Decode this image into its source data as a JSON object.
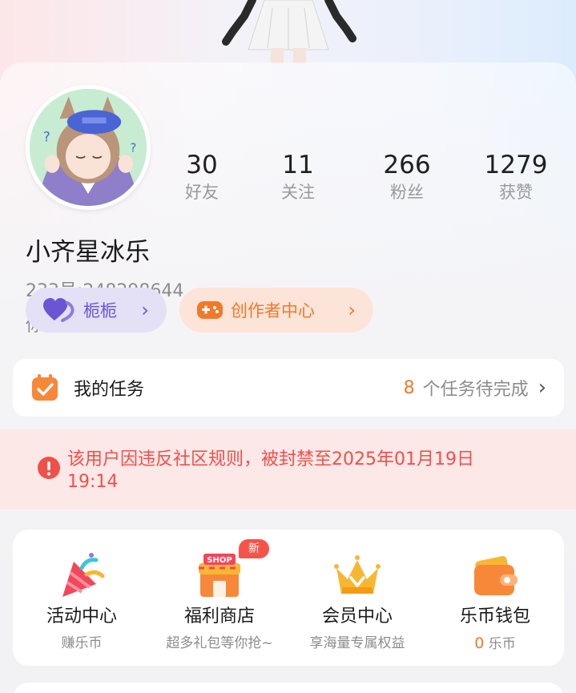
{
  "profile": {
    "username": "小齐星冰乐",
    "uid": "233号:248298644",
    "bio": "你什么都没有写",
    "avatar_icon": "anime-avatar-icon"
  },
  "stats": [
    {
      "value": "30",
      "label": "好友"
    },
    {
      "value": "11",
      "label": "关注"
    },
    {
      "value": "266",
      "label": "粉丝"
    },
    {
      "value": "1279",
      "label": "获赞"
    }
  ],
  "pills": {
    "guild": {
      "label": "栀栀",
      "icon": "heart-icon",
      "color": "#6b55d3"
    },
    "creator": {
      "label": "创作者中心",
      "icon": "gamepad-icon",
      "color": "#f07a2a"
    }
  },
  "tasks": {
    "title": "我的任务",
    "count": "8",
    "status": "个任务待完成",
    "icon": "task-calendar-icon"
  },
  "ban": {
    "text": "该用户因违反社区规则，被封禁至2025年01月19日 19:14",
    "color": "#f0504a"
  },
  "features": [
    {
      "name": "活动中心",
      "sub": "赚乐币",
      "icon": "party-popper-icon"
    },
    {
      "name": "福利商店",
      "sub": "超多礼包等你抢~",
      "icon": "shop-icon",
      "badge": "新"
    },
    {
      "name": "会员中心",
      "sub": "享海量专属权益",
      "icon": "crown-icon"
    },
    {
      "name": "乐币钱包",
      "coin_value": "0",
      "coin_unit": "乐币",
      "icon": "wallet-icon"
    }
  ],
  "colors": {
    "accent_orange": "#f07a2a",
    "accent_purple": "#6b55d3",
    "alert_red": "#f0504a"
  }
}
